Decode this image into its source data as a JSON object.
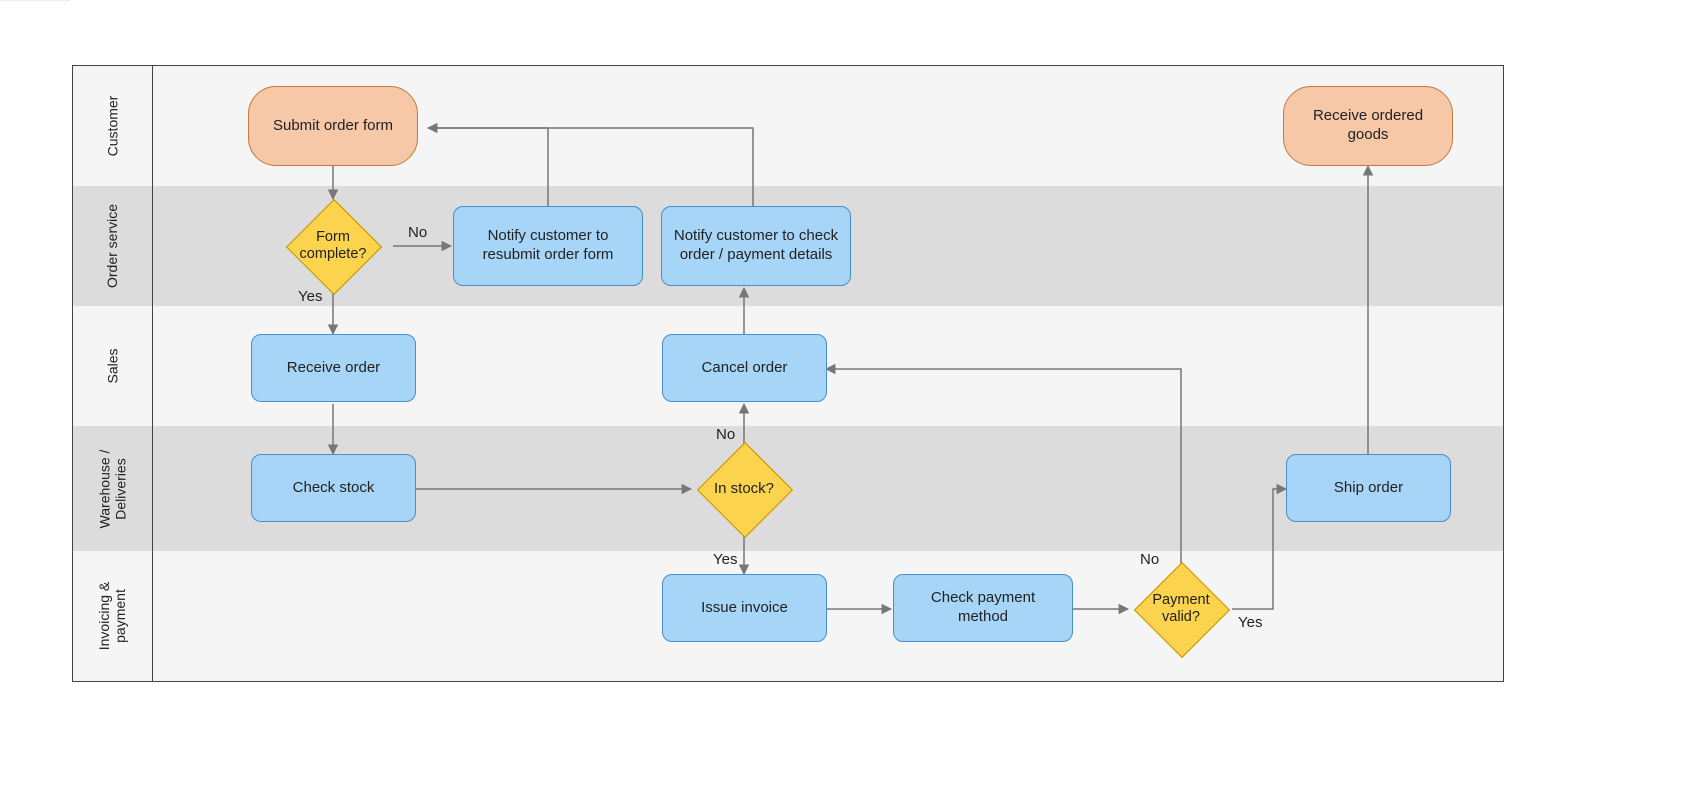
{
  "lanes": {
    "l0": "Customer",
    "l1": "Order service",
    "l2": "Sales",
    "l3": "Warehouse / Deliveries",
    "l4": "Invoicing & payment"
  },
  "nodes": {
    "submit_order": "Submit order form",
    "receive_goods": "Receive ordered goods",
    "form_complete": "Form complete?",
    "notify_resubmit": "Notify customer to resubmit order form",
    "notify_check": "Notify customer to check order / payment details",
    "receive_order": "Receive order",
    "cancel_order": "Cancel order",
    "check_stock": "Check stock",
    "in_stock": "In stock?",
    "ship_order": "Ship order",
    "issue_invoice": "Issue invoice",
    "check_payment": "Check payment method",
    "payment_valid": "Payment valid?"
  },
  "labels": {
    "no": "No",
    "yes": "Yes"
  },
  "colors": {
    "terminator_fill": "#f6c8a7",
    "process_fill": "#a6d5f7",
    "decision_fill": "#fcd34d"
  }
}
